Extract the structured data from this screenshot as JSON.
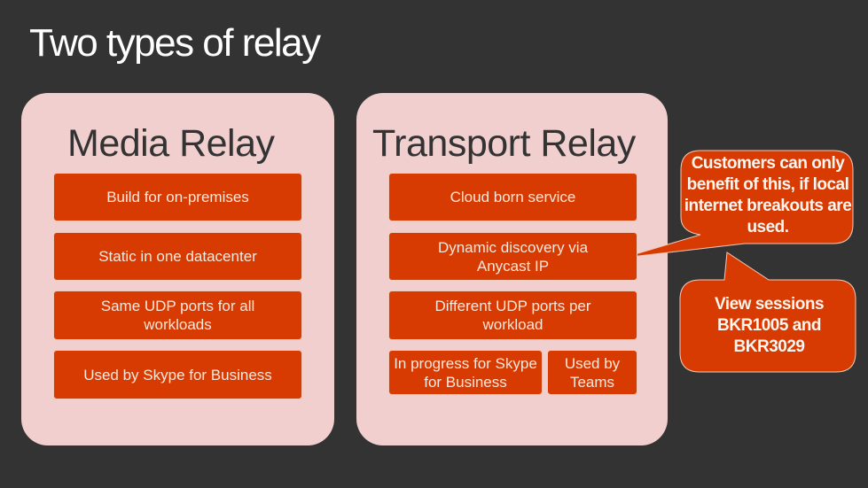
{
  "slide": {
    "title": "Two types of relay",
    "colors": {
      "background": "#333333",
      "panel": "#F0CFCE",
      "accent": "#D83B01"
    }
  },
  "media_relay": {
    "title": "Media Relay",
    "items": [
      "Build for on-premises",
      "Static in one datacenter",
      "Same UDP ports for all workloads",
      "Used by Skype for Business"
    ]
  },
  "transport_relay": {
    "title": "Transport Relay",
    "items": [
      "Cloud born service",
      "Dynamic discovery via Anycast IP",
      "Different UDP ports per workload"
    ],
    "split_items": [
      "In progress for Skype for Business",
      "Used by Teams"
    ]
  },
  "callouts": {
    "breakout_note": "Customers can only benefit of this, if local internet breakouts are used.",
    "sessions_note": "View sessions BKR1005 and BKR3029"
  }
}
